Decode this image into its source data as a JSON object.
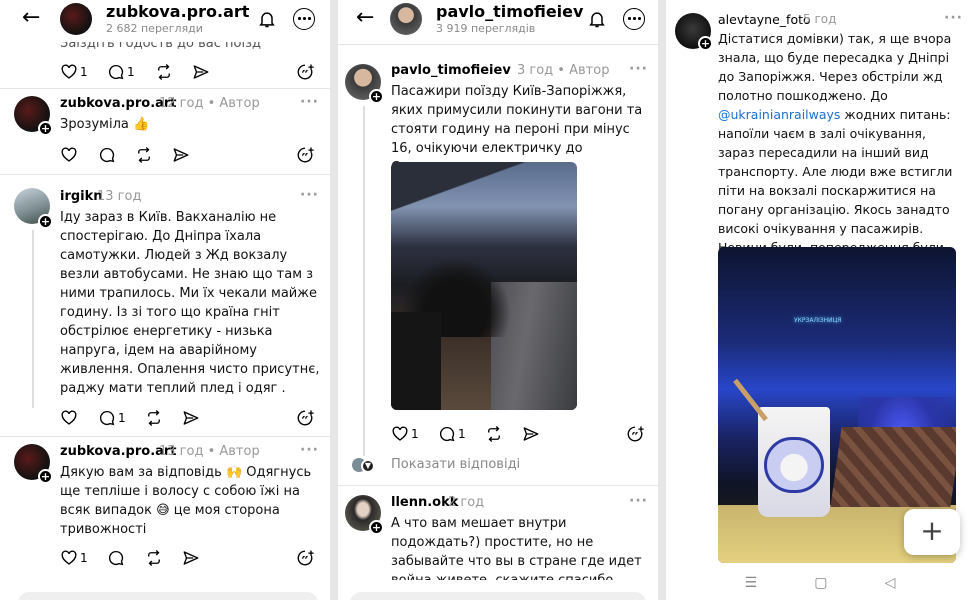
{
  "panel1": {
    "header": {
      "title": "zubkova.pro.art",
      "views": "2 682 перегляди"
    },
    "clipped_text": "Заїздіть годоств до вас поїзд",
    "top_actions": {
      "likes": "1",
      "comments": "1"
    },
    "posts": [
      {
        "user": "zubkova.pro.art",
        "meta": "12 год • Автор",
        "text": "Зрозуміла 👍",
        "likes": "",
        "comments": ""
      },
      {
        "user": "irgikn",
        "meta": "13 год",
        "text": "Іду зараз в Київ. Вакханалію не спостерігаю. До Дніпра їхала самотужки. Людей з Жд вокзалу везли автобусами. Не знаю що там з ними трапилось. Ми їх чекали майже годину. Із зі того що країна гніт обстрілює енергетику - низька напруга, ідем на аварійному живлення. Опалення чисто присутнє, раджу мати теплий плед і одяг .",
        "likes": "",
        "comments": "1"
      },
      {
        "user": "zubkova.pro.art",
        "meta": "13 год • Автор",
        "text": "Дякую вам за відповідь 🙌 Одягнусь ще тепліше і волосу с собою їжі на всяк випадок 😅 це моя сторона тривожності",
        "likes": "1",
        "comments": ""
      }
    ]
  },
  "panel2": {
    "header": {
      "title": "pavlo_timofieiev",
      "views": "3 919 переглядів"
    },
    "post": {
      "user": "pavlo_timofieiev",
      "meta": "3 год • Автор",
      "text": "Пасажири поїзду Київ-Запоріжжя, яких примусили покинути вагони та стояти годину на пероні при мінус 16, очікуючи електричку до Синельниково.",
      "likes": "1",
      "comments": "1"
    },
    "show_replies": "Показати відповіді",
    "reply": {
      "user": "llenn.okk",
      "meta": "2 год",
      "text": "А что вам мешает внутри подождать?) простите, но не забывайте что вы в стране где идет война живете, скажите спасибо вообще что хотят поезда 🙂"
    }
  },
  "panel3": {
    "post": {
      "user": "alevtayne_foto",
      "meta": "5 год",
      "text_before_link": "Дістатися домівки) так, я ще вчора знала, що буде пересадка у Дніпрі до Запоріжжя. Через обстріли жд полотно пошкоджено. До ",
      "link": "@ukrainianrailways",
      "text_after_link": " жодних питань: напоїли чаєм в залі очікування, зараз пересадили на інший вид транспорту. Але люди вже встигли піти на вокзалі поскаржитися на погану організацію. Якось занадто високі очікування у пасажирів. Новини були, попередження були, що ви хочете від співробітників?  Риторичне питання",
      "photo_sign": "УКРЗАЛІЗНИЦЯ"
    },
    "fab": "+"
  },
  "icons": {
    "back": "back-arrow-icon",
    "bell": "bell-icon",
    "more": "more-icon",
    "heart": "heart-icon",
    "comment": "comment-icon",
    "repost": "repost-icon",
    "share": "share-icon",
    "quote": "quote-icon"
  }
}
